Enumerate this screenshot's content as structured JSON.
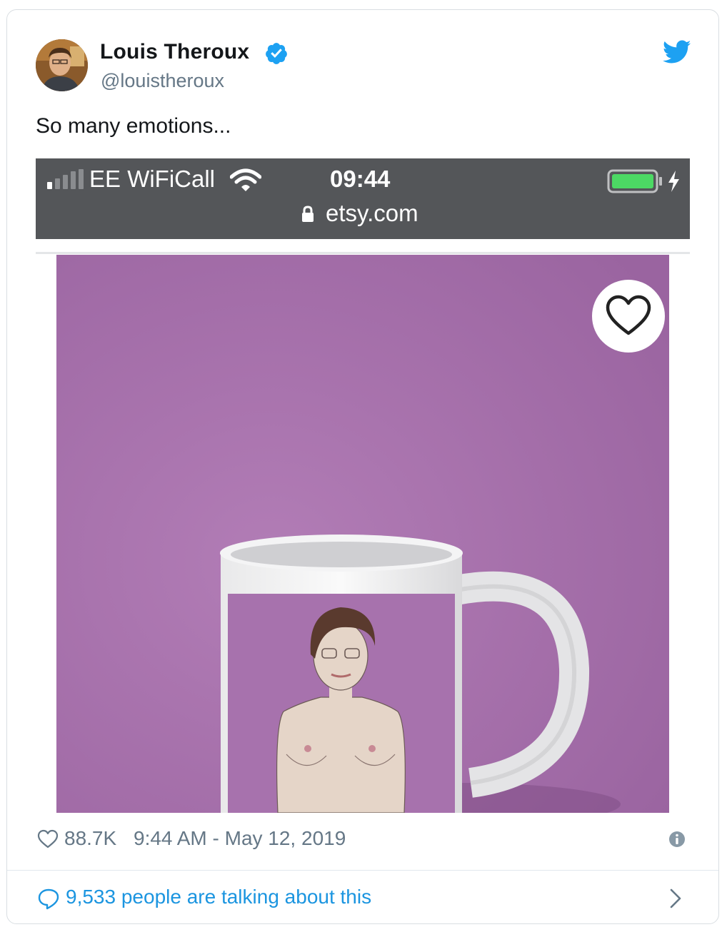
{
  "author": {
    "name": "Louis Theroux",
    "handle": "@louistheroux",
    "verified": true
  },
  "tweet": {
    "text": "So many emotions..."
  },
  "screenshot": {
    "carrier": "EE WiFiCall",
    "time": "09:44",
    "url": "etsy.com"
  },
  "stats": {
    "likes": "88.7K",
    "timestamp": "9:44 AM - May 12, 2019"
  },
  "conversation": {
    "text": "9,533 people are talking about this"
  },
  "colors": {
    "twitter_blue": "#1da1f2",
    "link_blue": "#1b95e0",
    "muted_text": "#657786",
    "statusbar_bg": "#545659",
    "product_bg": "#a46fa8",
    "battery_green": "#4cd964"
  },
  "icons": [
    "verified-badge-icon",
    "twitter-bird-icon",
    "signal-icon",
    "wifi-icon",
    "lock-icon",
    "battery-icon",
    "heart-icon",
    "info-icon",
    "reply-bubble-icon",
    "chevron-right-icon"
  ]
}
